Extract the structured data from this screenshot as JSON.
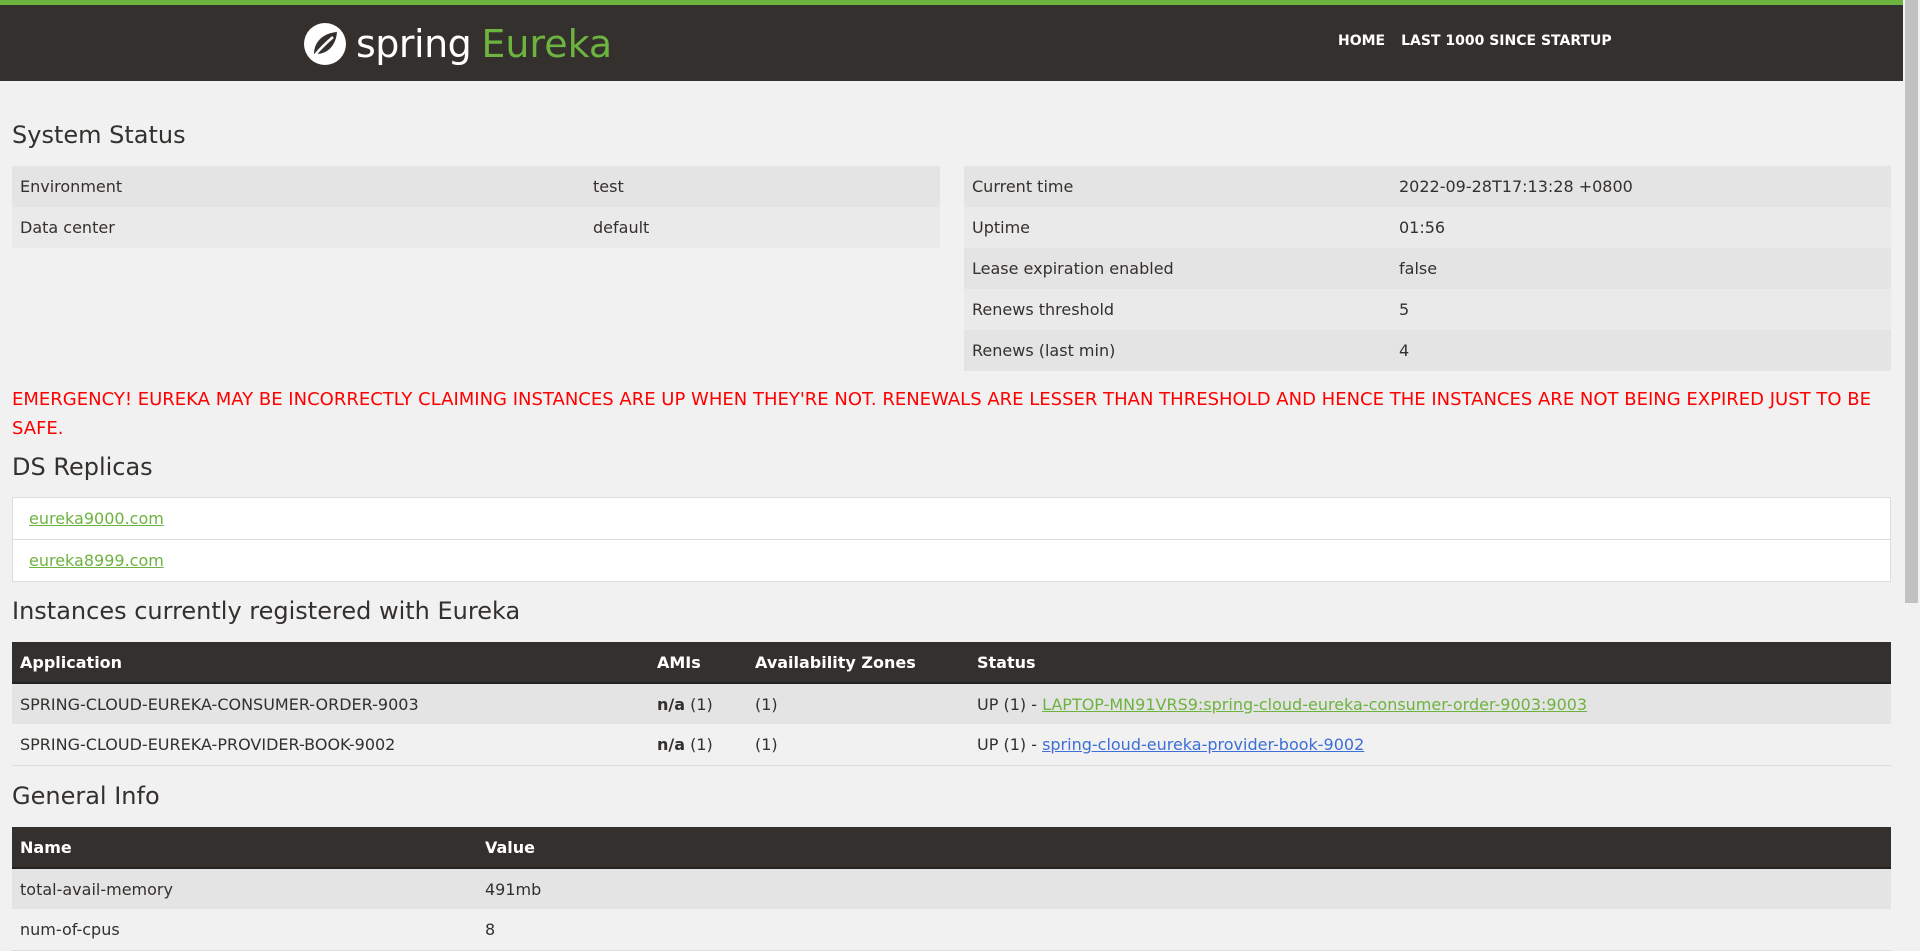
{
  "header": {
    "brand_spring": "spring",
    "brand_eureka": "Eureka",
    "nav": [
      "HOME",
      "LAST 1000 SINCE STARTUP"
    ],
    "colors": {
      "bar": "#34302d",
      "accent": "#6db33f"
    }
  },
  "system_status": {
    "title": "System Status",
    "left": [
      {
        "label": "Environment",
        "value": "test"
      },
      {
        "label": "Data center",
        "value": "default"
      }
    ],
    "right": [
      {
        "label": "Current time",
        "value": "2022-09-28T17:13:28 +0800"
      },
      {
        "label": "Uptime",
        "value": "01:56"
      },
      {
        "label": "Lease expiration enabled",
        "value": "false"
      },
      {
        "label": "Renews threshold",
        "value": "5"
      },
      {
        "label": "Renews (last min)",
        "value": "4"
      }
    ]
  },
  "emergency": "EMERGENCY! EUREKA MAY BE INCORRECTLY CLAIMING INSTANCES ARE UP WHEN THEY'RE NOT. RENEWALS ARE LESSER THAN THRESHOLD AND HENCE THE INSTANCES ARE NOT BEING EXPIRED JUST TO BE SAFE.",
  "replicas": {
    "title": "DS Replicas",
    "items": [
      "eureka9000.com",
      "eureka8999.com"
    ]
  },
  "instances": {
    "title": "Instances currently registered with Eureka",
    "headers": [
      "Application",
      "AMIs",
      "Availability Zones",
      "Status"
    ],
    "rows": [
      {
        "application": "SPRING-CLOUD-EUREKA-CONSUMER-ORDER-9003",
        "ami_bold": "n/a",
        "ami_count": "(1)",
        "zones": "(1)",
        "status_prefix": "UP (1) - ",
        "status_link": "LAPTOP-MN91VRS9:spring-cloud-eureka-consumer-order-9003:9003"
      },
      {
        "application": "SPRING-CLOUD-EUREKA-PROVIDER-BOOK-9002",
        "ami_bold": "n/a",
        "ami_count": "(1)",
        "zones": "(1)",
        "status_prefix": "UP (1) - ",
        "status_link": "spring-cloud-eureka-provider-book-9002"
      }
    ]
  },
  "general_info": {
    "title": "General Info",
    "headers": [
      "Name",
      "Value"
    ],
    "rows": [
      {
        "name": "total-avail-memory",
        "value": "491mb"
      },
      {
        "name": "num-of-cpus",
        "value": "8"
      }
    ]
  }
}
